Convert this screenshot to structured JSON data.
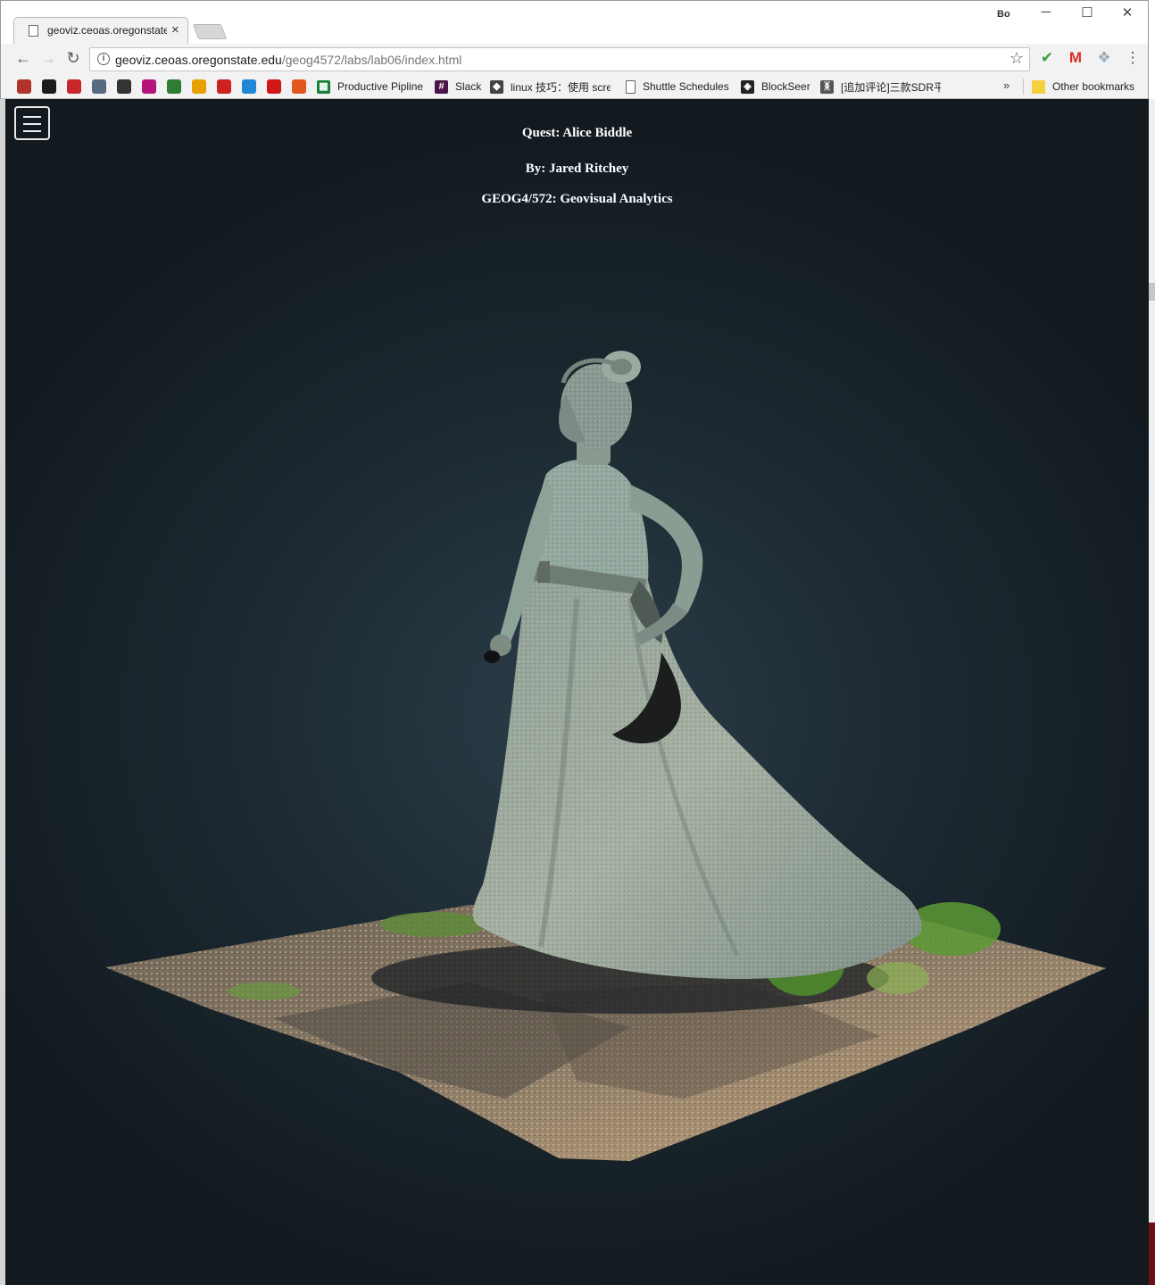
{
  "browser": {
    "tab": {
      "title": "geoviz.ceoas.oregonstate.edu",
      "close": "×"
    },
    "profile_label": "Bo",
    "window": {
      "minimize": "─",
      "maximize": "☐",
      "close": "✕"
    },
    "nav": {
      "back": "←",
      "forward": "→",
      "reload": "↻"
    },
    "address": {
      "host": "geoviz.ceoas.oregonstate.edu",
      "path": "/geog4572/labs/lab06/index.html"
    },
    "star": "☆",
    "extensions": {
      "check": "✔",
      "gmail": "M",
      "dropbox": "❖",
      "menu": "⋮"
    },
    "bookmarks": [
      {
        "icon": "bookmark-app-icon",
        "label": "",
        "color": "#b0342c"
      },
      {
        "icon": "bookmark-app-icon",
        "label": "",
        "color": "#1b1b1b"
      },
      {
        "icon": "bookmark-app-icon",
        "label": "",
        "color": "#c8262d"
      },
      {
        "icon": "bookmark-app-icon",
        "label": "",
        "color": "#566b80"
      },
      {
        "icon": "bookmark-app-icon",
        "label": "",
        "color": "#333333"
      },
      {
        "icon": "bookmark-app-icon",
        "label": "",
        "color": "#b5157a"
      },
      {
        "icon": "bookmark-app-icon",
        "label": "",
        "color": "#2f7d32"
      },
      {
        "icon": "bookmark-app-icon",
        "label": "",
        "color": "#e6a100"
      },
      {
        "icon": "bookmark-app-icon",
        "label": "",
        "color": "#cc2222"
      },
      {
        "icon": "bookmark-app-icon",
        "label": "",
        "color": "#1f87d6"
      },
      {
        "icon": "bookmark-app-icon",
        "label": "",
        "color": "#d01717"
      },
      {
        "icon": "bookmark-app-icon",
        "label": "",
        "color": "#e2571e"
      }
    ],
    "named_bookmarks": [
      {
        "label": "Productive Pipline",
        "icon_text": "▦",
        "color": "#188038"
      },
      {
        "label": "Slack",
        "icon_text": "#",
        "color": "#4a154b"
      },
      {
        "label": "linux 技巧：使用 scre",
        "icon_text": "◆",
        "color": "#444444"
      },
      {
        "label": "Shuttle Schedules",
        "icon_text": "",
        "color": "#ffffff"
      },
      {
        "label": "BlockSeer",
        "icon_text": "◈",
        "color": "#222222"
      },
      {
        "label": "[追加评论]三款SDR平",
        "icon_text": "ᛤ",
        "color": "#555555"
      }
    ],
    "more_bookmarks": "»",
    "other_bookmarks": "Other bookmarks"
  },
  "page": {
    "title": "Quest: Alice Biddle",
    "author": "By: Jared Ritchey",
    "course": "GEOG4/572: Geovisual Analytics",
    "menu_icon": "hamburger-menu-icon",
    "background_color": "#1d2a32",
    "model": "statue-point-cloud"
  }
}
